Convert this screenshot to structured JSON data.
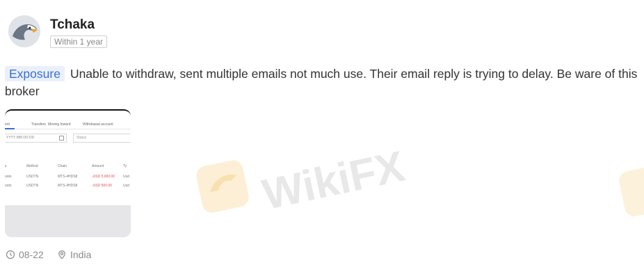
{
  "post": {
    "author": "Tchaka",
    "time_badge": "Within 1 year",
    "tag": "Exposure",
    "content": "Unable to withdraw, sent multiple emails not much use. Their email reply is trying to delay. Be ware of this broker",
    "date": "08-22",
    "location": "India"
  },
  "attachment": {
    "tabs": [
      "ent",
      "Transfers",
      "Moving Inward",
      "Withdrawal account"
    ],
    "date_range": "YYYY MM DD DD",
    "status_placeholder": "Status",
    "table_headers": [
      "s",
      "Method",
      "Chain",
      "Amount",
      "Ty"
    ],
    "rows": [
      [
        "oots",
        "USDTN",
        "MTS-4HDS8",
        "-USD 5,000.00",
        "Usd"
      ],
      [
        "oots",
        "USDTN",
        "MTS-4HDS8",
        "-USD 500.00",
        "Usd"
      ]
    ]
  },
  "watermark": {
    "text": "WikiFX",
    "color": "#f3c66b"
  },
  "colors": {
    "tag_bg": "#eaf0fb",
    "tag_text": "#3a6fd8",
    "meta_text": "#8a8a8a"
  }
}
